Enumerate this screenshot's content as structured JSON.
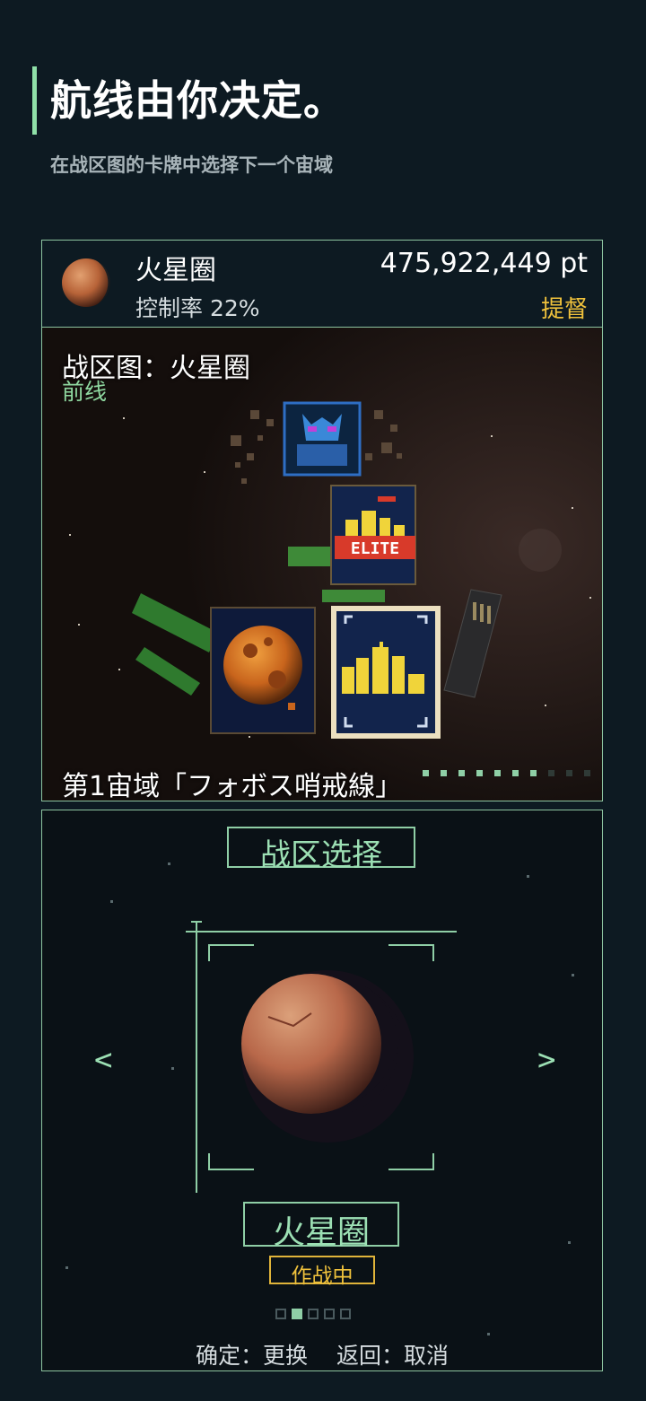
{
  "header": {
    "title": "航线由你决定。",
    "subtitle": "在战区图的卡牌中选择下一个宙域"
  },
  "info": {
    "area_name": "火星圈",
    "control_rate": "控制率 22%",
    "score": "475,922,449 pt",
    "rank": "提督"
  },
  "map": {
    "title": "战区图：火星圈",
    "front_label": "前线",
    "sector_label": "第1宙域「フォボス哨戒線」",
    "elite_badge": "ELITE",
    "sector_progress": {
      "total": 10,
      "cleared": 7
    }
  },
  "select": {
    "title": "战区选择",
    "prev_arrow": "<",
    "next_arrow": ">",
    "planet_name": "火星圈",
    "status": "作战中",
    "pager": {
      "count": 5,
      "active": 1
    },
    "controls": {
      "confirm": "确定：更换",
      "back": "返回：取消"
    }
  },
  "colors": {
    "background": "#0d1a22",
    "accent_green": "#8fcfa6",
    "rank_gold": "#f0c23c",
    "border": "#8cc4a0"
  },
  "icons": [
    "mars-thumbnail-icon",
    "boss-card-icon",
    "elite-city-card-icon",
    "asteroid-card-icon",
    "city-card-icon",
    "mars-planet-icon"
  ]
}
